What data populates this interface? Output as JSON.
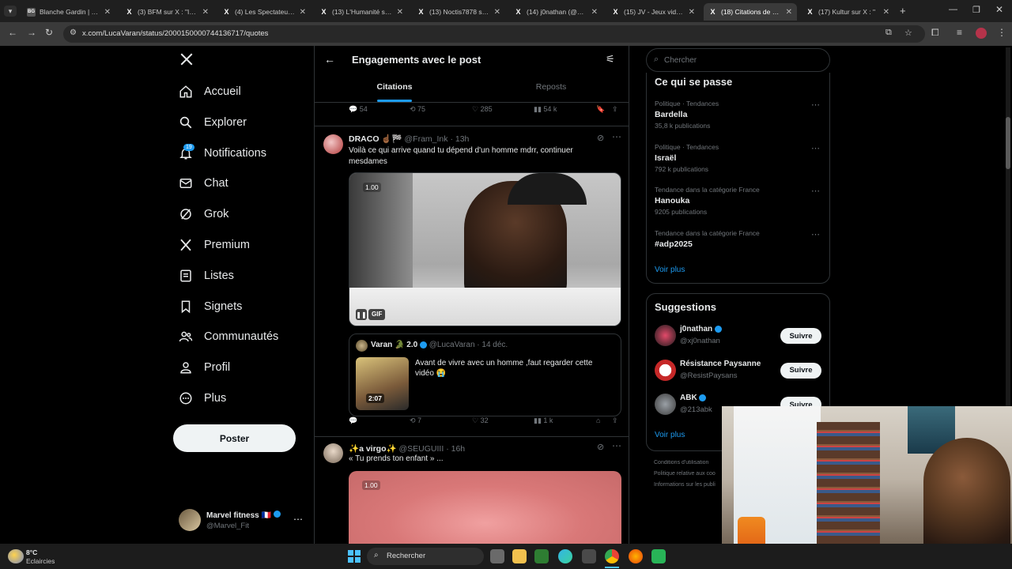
{
  "browser": {
    "tabs": [
      {
        "title": "Blanche Gardin | VOD",
        "favicon": "BG"
      },
      {
        "title": "(3) BFM sur X : \"Inséc",
        "favicon": "X"
      },
      {
        "title": "(4) Les Spectateurs su",
        "favicon": "X"
      },
      {
        "title": "(13) L'Humanité sur X",
        "favicon": "X"
      },
      {
        "title": "(13) Noctis7878 sur X",
        "favicon": "X"
      },
      {
        "title": "(14) j0nathan (@xj0n",
        "favicon": "X"
      },
      {
        "title": "(15) JV - Jeux vidéo s",
        "favicon": "X"
      },
      {
        "title": "(18) Citations de ce p",
        "favicon": "X"
      },
      {
        "title": "(17) Kultur sur X : \"",
        "favicon": "X"
      }
    ],
    "url": "x.com/LucaVaran/status/2000150000744136717/quotes"
  },
  "nav": {
    "items": [
      {
        "label": "Accueil",
        "icon": "home-icon"
      },
      {
        "label": "Explorer",
        "icon": "search-icon"
      },
      {
        "label": "Notifications",
        "icon": "bell-icon"
      },
      {
        "label": "Chat",
        "icon": "mail-icon"
      },
      {
        "label": "Grok",
        "icon": "grok-icon"
      },
      {
        "label": "Premium",
        "icon": "x-logo-icon"
      },
      {
        "label": "Listes",
        "icon": "list-icon"
      },
      {
        "label": "Signets",
        "icon": "bookmark-icon"
      },
      {
        "label": "Communautés",
        "icon": "people-icon"
      },
      {
        "label": "Profil",
        "icon": "person-icon"
      },
      {
        "label": "Plus",
        "icon": "more-circle-icon"
      }
    ],
    "notif_count": "19",
    "post_button": "Poster",
    "account": {
      "name": "Marvel fitness",
      "flag": "🇫🇷",
      "handle": "@Marvel_Fit"
    }
  },
  "header": {
    "title": "Engagements avec le post",
    "tabs": [
      "Citations",
      "Reposts"
    ]
  },
  "main_post_actions": {
    "replies": "54",
    "reposts": "75",
    "likes": "285",
    "views": "54 k"
  },
  "posts": [
    {
      "name": "DRACO",
      "emojis": "☝🏾🏁",
      "handle": "@Fram_Ink",
      "time": "· 13h",
      "text": "Voilà ce qui arrive quand tu dépend d'un homme mdrr, continuer mesdames",
      "gif_badge": "GIF",
      "video_time": "1.00",
      "quoted": {
        "name": "Varan",
        "name_suffix": "🐊 2.0",
        "handle": "@LucaVaran",
        "date": "· 14 déc.",
        "text": "Avant de vivre avec un homme ,faut regarder cette vidéo 😭",
        "duration": "2:07"
      },
      "actions": {
        "replies": "",
        "reposts": "7",
        "likes": "32",
        "views": "1 k"
      }
    },
    {
      "name": "✨a virgo✨",
      "handle": "@SEUGUIII",
      "time": "· 16h",
      "text": "« Tu prends ton enfant » ...",
      "video_time": "1.00"
    }
  ],
  "search": {
    "placeholder": "Chercher"
  },
  "trends": {
    "title": "Ce qui se passe",
    "items": [
      {
        "category": "Politique · Tendances",
        "name": "Bardella",
        "count": "35,8 k publications"
      },
      {
        "category": "Politique · Tendances",
        "name": "Israël",
        "count": "792 k publications"
      },
      {
        "category": "Tendance dans la catégorie France",
        "name": "Hanouka",
        "count": "9205 publications"
      },
      {
        "category": "Tendance dans la catégorie France",
        "name": "#adp2025",
        "count": ""
      }
    ],
    "more": "Voir plus"
  },
  "suggestions": {
    "title": "Suggestions",
    "items": [
      {
        "name": "j0nathan",
        "handle": "@xj0nathan",
        "verified": true
      },
      {
        "name": "Résistance Paysanne",
        "handle": "@ResistPaysans",
        "verified": false
      },
      {
        "name": "ABK",
        "handle": "@213abk",
        "verified": true
      }
    ],
    "follow_label": "Suivre",
    "more": "Voir plus"
  },
  "footer_links": [
    "Conditions d'utilisation",
    "Politique relative aux coo",
    "Informations sur les publi"
  ],
  "taskbar": {
    "weather_temp": "8°C",
    "weather_desc": "Eclaircies",
    "search": "Rechercher"
  },
  "colors": {
    "accent": "#1d9bf0",
    "bg": "#000000",
    "border": "#2f3336",
    "muted": "#71767b"
  }
}
